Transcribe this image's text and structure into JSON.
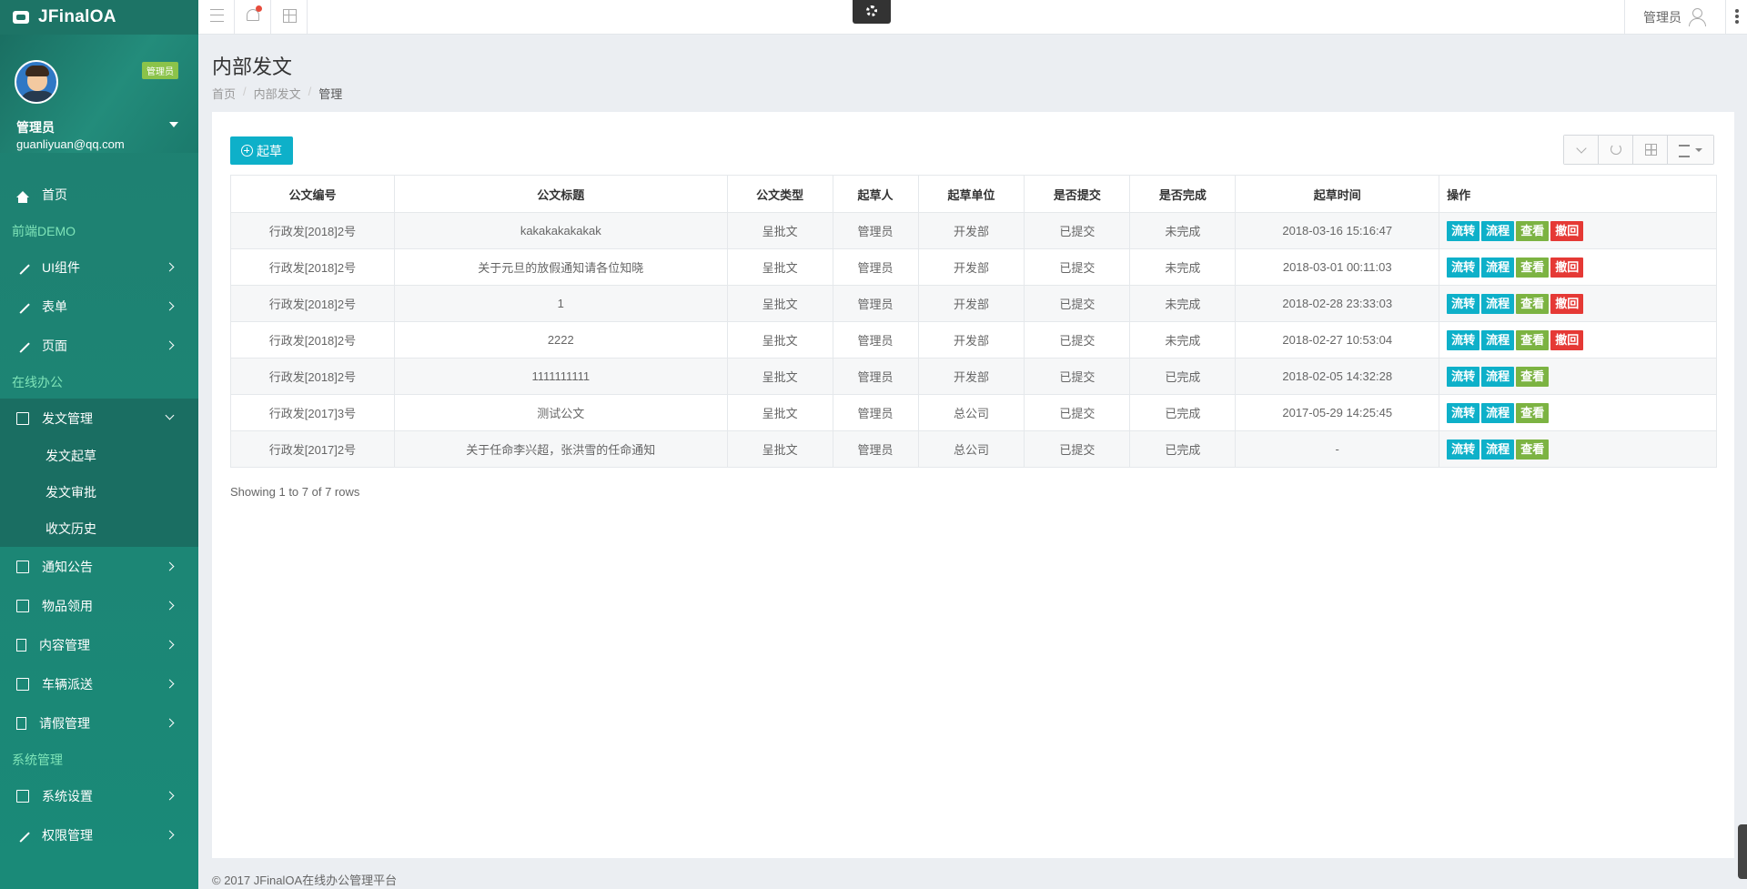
{
  "brand": {
    "name": "JFinalOA"
  },
  "profile": {
    "badge": "管理员",
    "name": "管理员",
    "email": "guanliyuan@qq.com"
  },
  "nav": {
    "home": "首页",
    "section_front": "前端DEMO",
    "ui": "UI组件",
    "form": "表单",
    "page": "页面",
    "section_office": "在线办公",
    "doc_mgmt": "发文管理",
    "doc_draft": "发文起草",
    "doc_approve": "发文审批",
    "doc_history": "收文历史",
    "notice": "通知公告",
    "goods": "物品领用",
    "content": "内容管理",
    "vehicle": "车辆派送",
    "leave": "请假管理",
    "section_system": "系统管理",
    "sys_settings": "系统设置",
    "permissions": "权限管理"
  },
  "topbar": {
    "user_label": "管理员"
  },
  "page": {
    "title": "内部发文",
    "breadcrumb": [
      "首页",
      "内部发文",
      "管理"
    ],
    "draft_button": "起草",
    "showing": "Showing 1 to 7 of 7 rows",
    "footer": "© 2017 JFinalOA在线办公管理平台"
  },
  "table": {
    "headers": [
      "公文编号",
      "公文标题",
      "公文类型",
      "起草人",
      "起草单位",
      "是否提交",
      "是否完成",
      "起草时间",
      "操作"
    ],
    "action_labels": {
      "transfer": "流转",
      "flow": "流程",
      "view": "查看",
      "revoke": "撤回"
    },
    "rows": [
      [
        "行政发[2018]2号",
        "kakakakakakak",
        "呈批文",
        "管理员",
        "开发部",
        "已提交",
        "未完成",
        "2018-03-16 15:16:47"
      ],
      [
        "行政发[2018]2号",
        "关于元旦的放假通知请各位知晓",
        "呈批文",
        "管理员",
        "开发部",
        "已提交",
        "未完成",
        "2018-03-01 00:11:03"
      ],
      [
        "行政发[2018]2号",
        "1",
        "呈批文",
        "管理员",
        "开发部",
        "已提交",
        "未完成",
        "2018-02-28 23:33:03"
      ],
      [
        "行政发[2018]2号",
        "2222",
        "呈批文",
        "管理员",
        "开发部",
        "已提交",
        "未完成",
        "2018-02-27 10:53:04"
      ],
      [
        "行政发[2018]2号",
        "1111111111",
        "呈批文",
        "管理员",
        "开发部",
        "已提交",
        "已完成",
        "2018-02-05 14:32:28"
      ],
      [
        "行政发[2017]3号",
        "测试公文",
        "呈批文",
        "管理员",
        "总公司",
        "已提交",
        "已完成",
        "2017-05-29 14:25:45"
      ],
      [
        "行政发[2017]2号",
        "关于任命李兴超，张洪雪的任命通知",
        "呈批文",
        "管理员",
        "总公司",
        "已提交",
        "已完成",
        "-"
      ]
    ]
  },
  "colors": {
    "sidebar": "#1a8a78",
    "accent": "#0eb0c9",
    "green": "#7cb342",
    "red": "#e53935"
  }
}
